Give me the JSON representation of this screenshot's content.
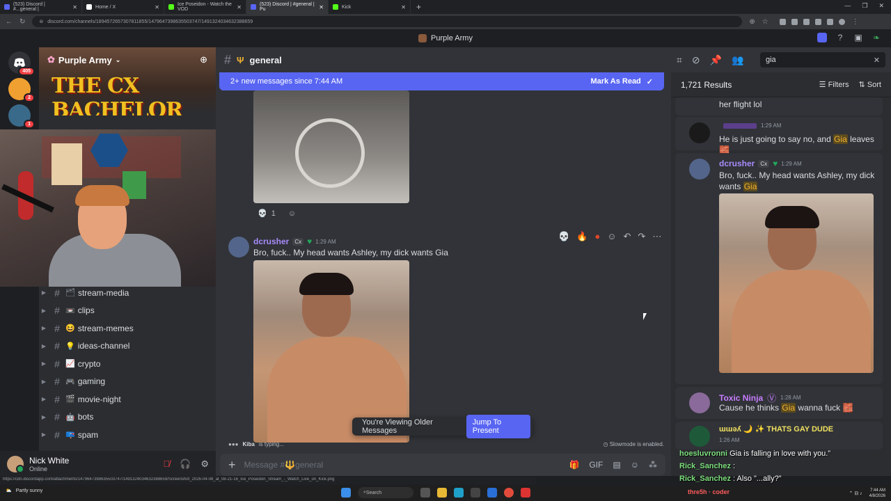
{
  "browser": {
    "tabs": [
      {
        "label": "(523) Discord | #...general |",
        "color": "#5865f2"
      },
      {
        "label": "Home / X",
        "color": "#000000"
      },
      {
        "label": "Ice Poseidon - Watch the VOD",
        "color": "#53fc18"
      },
      {
        "label": "(523) Discord | #general | Pu",
        "color": "#5865f2"
      },
      {
        "label": "Kick",
        "color": "#53fc18"
      }
    ],
    "url": "discord.com/channels/1894572657307811855/1479647398635503747/1491324034632388659"
  },
  "window_title": "Purple Army",
  "server": {
    "name": "Purple Army",
    "banner_text": "THE CX BACHELOR",
    "rail_badges": [
      "405",
      "2",
      "1"
    ]
  },
  "channels": [
    {
      "emoji": "",
      "label": "stream-media"
    },
    {
      "emoji": "",
      "label": "clips"
    },
    {
      "emoji": "😆",
      "label": "stream-memes"
    },
    {
      "emoji": "💡",
      "label": "ideas-channel"
    },
    {
      "emoji": "📈",
      "label": "crypto"
    },
    {
      "emoji": "🎮",
      "label": "gaming"
    },
    {
      "emoji": "🎬",
      "label": "movie-night"
    },
    {
      "emoji": "🤖",
      "label": "bots"
    },
    {
      "emoji": "",
      "label": "spam"
    }
  ],
  "user": {
    "name": "Nick White",
    "status": "Online"
  },
  "channel": {
    "name": "general",
    "new_messages": "2+ new messages since 7:44 AM",
    "mark_read": "Mark As Read"
  },
  "messages": {
    "reaction_count": "1",
    "msg": {
      "user": "dcrusher",
      "tag": "Cx",
      "time": "1:29 AM",
      "text": "Bro, fuck.. My head wants Ashley, my dick wants Gia"
    }
  },
  "jump": {
    "viewing": "You're Viewing Older Messages",
    "button": "Jump To Present"
  },
  "typing": {
    "user": "Kiba",
    "text": "is typing..."
  },
  "slowmode": "Slowmode is enabled.",
  "composer": {
    "placeholder": "Message #🔱general"
  },
  "search": {
    "query": "gia",
    "results_count": "1,721 Results",
    "filters": "Filters",
    "sort": "Sort",
    "results": [
      {
        "text": "her flight lol"
      },
      {
        "user": "",
        "time": "1:29 AM",
        "pre": "He is just going to say no, and ",
        "hl": "Gia",
        "post": " leaves"
      },
      {
        "user": "dcrusher",
        "tag": "Cx",
        "time": "1:29 AM",
        "pre": "Bro, fuck.. My head wants Ashley, my dick wants ",
        "hl": "Gia",
        "post": ""
      },
      {
        "user": "Toxic Ninja",
        "time": "1:28 AM",
        "pre": "Cause he thinks ",
        "hl": "Gia",
        "post": " wanna fuck"
      },
      {
        "user": "ɯɯǝʎ 🌙 ✨ THATS GAY DUDE",
        "time": "1:26 AM"
      }
    ]
  },
  "overlay_chat": [
    {
      "user": "hoesluvronni",
      "text": "Gia is falling in love with you.”"
    },
    {
      "user": "Rick_Sanchez",
      "text": ""
    },
    {
      "user": "Rick_Sanchez",
      "text": "Also \"...ally?\""
    }
  ],
  "overlay_name": "thre5h · coder",
  "status_url": "https://cdn.discordapp.com/attachments/1479647398635503747/1491324034632388659/Screenshot_2026-04-08_at_08-21-16_Ice_Poseidon_Stream_-_Watch_Live_on_Kick.png",
  "taskbar": {
    "weather": "Partly sunny",
    "search": "Search",
    "time": "7:44 AM",
    "date": "4/8/2026"
  }
}
